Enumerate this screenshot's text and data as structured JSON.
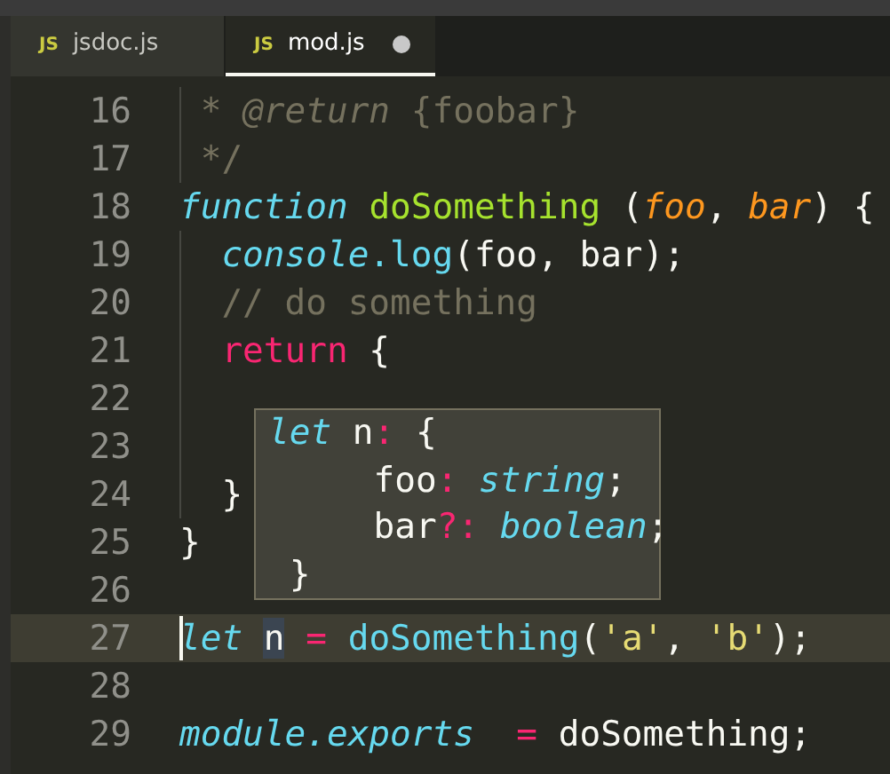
{
  "tabs": [
    {
      "badge": "JS",
      "label": "jsdoc.js",
      "selected": false,
      "modified": false
    },
    {
      "badge": "JS",
      "label": "mod.js",
      "selected": true,
      "modified": true
    }
  ],
  "editor": {
    "lines": [
      {
        "number": "16",
        "current": false,
        "tokens": [
          {
            "text": " * ",
            "kind": "comment"
          },
          {
            "text": "@return",
            "kind": "tag"
          },
          {
            "text": " {foobar}",
            "kind": "comment"
          }
        ]
      },
      {
        "number": "17",
        "current": false,
        "tokens": [
          {
            "text": " */",
            "kind": "comment"
          }
        ]
      },
      {
        "number": "18",
        "current": false,
        "tokens": [
          {
            "text": "function ",
            "kind": "keyword"
          },
          {
            "text": "doSomething ",
            "kind": "entity"
          },
          {
            "text": "(",
            "kind": "plain"
          },
          {
            "text": "foo",
            "kind": "param"
          },
          {
            "text": ", ",
            "kind": "plain"
          },
          {
            "text": "bar",
            "kind": "param"
          },
          {
            "text": ") {",
            "kind": "plain"
          }
        ]
      },
      {
        "number": "19",
        "current": false,
        "tokens": [
          {
            "text": "  console",
            "kind": "keyword"
          },
          {
            "text": ".log",
            "kind": "method"
          },
          {
            "text": "(foo, bar);",
            "kind": "plain"
          }
        ]
      },
      {
        "number": "20",
        "current": false,
        "tokens": [
          {
            "text": "  // do something",
            "kind": "comment"
          }
        ]
      },
      {
        "number": "21",
        "current": false,
        "tokens": [
          {
            "text": "  return",
            "kind": "operator"
          },
          {
            "text": " {",
            "kind": "plain"
          }
        ]
      },
      {
        "number": "22",
        "current": false
      },
      {
        "number": "23",
        "current": false
      },
      {
        "number": "24",
        "current": false,
        "tokens": [
          {
            "text": "  }",
            "kind": "plain"
          }
        ]
      },
      {
        "number": "25",
        "current": false,
        "tokens": [
          {
            "text": "}",
            "kind": "plain"
          }
        ]
      },
      {
        "number": "26",
        "current": false
      },
      {
        "number": "27",
        "current": true,
        "tokens": [
          {
            "text": "let ",
            "kind": "keyword"
          },
          {
            "text": "n",
            "kind": "plain",
            "highlighted": true
          },
          {
            "text": " = ",
            "kind": "operator"
          },
          {
            "text": "doSomething",
            "kind": "method"
          },
          {
            "text": "(",
            "kind": "plain"
          },
          {
            "text": "'a'",
            "kind": "string"
          },
          {
            "text": ", ",
            "kind": "plain"
          },
          {
            "text": "'b'",
            "kind": "string"
          },
          {
            "text": ");",
            "kind": "plain"
          }
        ]
      },
      {
        "number": "28",
        "current": false
      },
      {
        "number": "29",
        "current": false,
        "tokens": [
          {
            "text": "module",
            "kind": "keyword"
          },
          {
            "text": ".exports  ",
            "kind": "keyword"
          },
          {
            "text": "= ",
            "kind": "operator"
          },
          {
            "text": "doSomething;",
            "kind": "plain"
          }
        ]
      }
    ],
    "hover": {
      "lines": [
        {
          "tokens": [
            {
              "text": "let ",
              "kind": "keyword"
            },
            {
              "text": "n",
              "kind": "plain"
            },
            {
              "text": ": ",
              "kind": "operator"
            },
            {
              "text": "{",
              "kind": "plain"
            }
          ]
        },
        {
          "tokens": [
            {
              "text": "     foo",
              "kind": "plain"
            },
            {
              "text": ": ",
              "kind": "operator"
            },
            {
              "text": "string",
              "kind": "keyword"
            },
            {
              "text": ";",
              "kind": "plain"
            }
          ]
        },
        {
          "tokens": [
            {
              "text": "     bar",
              "kind": "plain"
            },
            {
              "text": "?: ",
              "kind": "operator"
            },
            {
              "text": "boolean",
              "kind": "keyword"
            },
            {
              "text": ";",
              "kind": "plain"
            }
          ]
        },
        {
          "tokens": [
            {
              "text": " }",
              "kind": "plain"
            }
          ]
        }
      ]
    }
  }
}
